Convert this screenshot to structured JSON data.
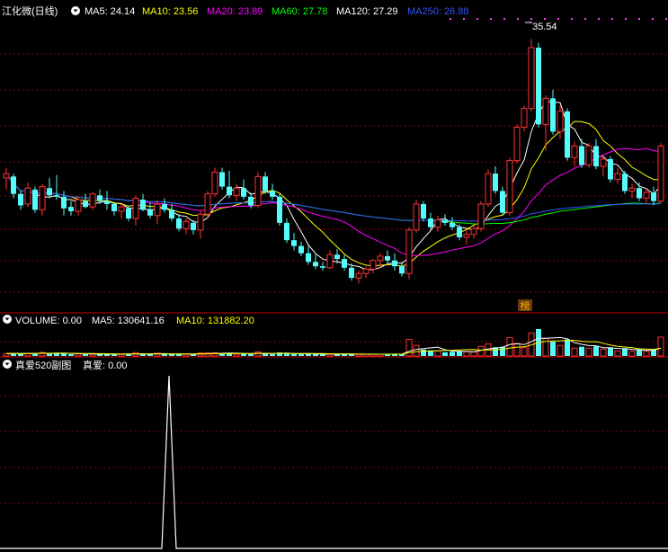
{
  "stock": {
    "name": "江化微(日线)"
  },
  "ma_legend": [
    {
      "text": "MA5: 24.14",
      "color": "#ffffff"
    },
    {
      "text": "MA10: 23.56",
      "color": "#ffff00"
    },
    {
      "text": "MA20: 23.89",
      "color": "#ff00ff"
    },
    {
      "text": "MA60: 27.78",
      "color": "#00ff00"
    },
    {
      "text": "MA120: 27.29",
      "color": "#ffffff"
    },
    {
      "text": "MA250: 26.88",
      "color": "#3355ff"
    }
  ],
  "peak_label": "35.54",
  "bang_label": "榜",
  "volume_legend": [
    {
      "text": "VOLUME: 0.00",
      "color": "#ffffff"
    },
    {
      "text": "MA5: 130641.16",
      "color": "#ffffff"
    },
    {
      "text": "MA10: 131882.20",
      "color": "#ffff00"
    }
  ],
  "sub_legend": {
    "name": "真爱520副图",
    "value": "真爱: 0.00"
  },
  "colors": {
    "up": "#ff3333",
    "down": "#54fcfc",
    "grid": "#8b0000",
    "bg": "#000000"
  },
  "chart_data": [
    {
      "type": "candlestick",
      "ylim": [
        18,
        37
      ],
      "candles": [
        [
          26.2,
          26.9,
          25.4,
          26.5
        ],
        [
          26.3,
          26.5,
          24.8,
          25.1
        ],
        [
          25.1,
          25.3,
          24.0,
          24.3
        ],
        [
          24.4,
          25.9,
          24.2,
          25.5
        ],
        [
          25.4,
          25.6,
          23.8,
          24.0
        ],
        [
          24.0,
          25.8,
          23.6,
          25.6
        ],
        [
          25.5,
          26.2,
          24.8,
          25.0
        ],
        [
          25.0,
          26.4,
          24.7,
          24.9
        ],
        [
          24.9,
          25.3,
          23.6,
          24.1
        ],
        [
          24.2,
          24.6,
          23.6,
          23.9
        ],
        [
          23.9,
          24.9,
          23.6,
          24.7
        ],
        [
          24.6,
          25.1,
          24.1,
          24.2
        ],
        [
          24.2,
          25.2,
          24.0,
          25.1
        ],
        [
          25.0,
          25.4,
          24.4,
          24.6
        ],
        [
          24.6,
          25.3,
          24.0,
          24.4
        ],
        [
          24.4,
          24.5,
          23.6,
          23.9
        ],
        [
          23.9,
          24.4,
          23.4,
          24.2
        ],
        [
          24.1,
          24.3,
          23.2,
          23.4
        ],
        [
          23.4,
          25.0,
          22.9,
          24.8
        ],
        [
          24.7,
          25.1,
          23.9,
          24.0
        ],
        [
          24.0,
          24.5,
          23.4,
          23.6
        ],
        [
          23.6,
          24.7,
          23.0,
          24.4
        ],
        [
          24.4,
          24.8,
          23.8,
          24.0
        ],
        [
          24.0,
          24.4,
          23.2,
          23.4
        ],
        [
          23.4,
          23.7,
          22.5,
          22.7
        ],
        [
          22.7,
          23.4,
          22.3,
          23.2
        ],
        [
          23.1,
          23.3,
          22.3,
          22.6
        ],
        [
          22.6,
          23.9,
          22.0,
          23.7
        ],
        [
          23.7,
          25.3,
          23.4,
          25.1
        ],
        [
          25.1,
          26.9,
          24.9,
          26.6
        ],
        [
          26.6,
          26.9,
          25.4,
          25.6
        ],
        [
          25.6,
          26.7,
          24.8,
          25.0
        ],
        [
          25.0,
          25.8,
          24.6,
          25.5
        ],
        [
          25.5,
          26.1,
          24.7,
          24.9
        ],
        [
          24.9,
          25.2,
          24.1,
          24.3
        ],
        [
          24.3,
          26.6,
          24.1,
          26.3
        ],
        [
          26.3,
          26.6,
          25.1,
          25.3
        ],
        [
          25.3,
          25.8,
          24.7,
          24.9
        ],
        [
          24.9,
          25.1,
          22.9,
          23.1
        ],
        [
          23.1,
          23.4,
          21.7,
          21.9
        ],
        [
          21.9,
          22.4,
          21.2,
          21.5
        ],
        [
          21.5,
          21.8,
          20.8,
          21.0
        ],
        [
          21.0,
          21.5,
          20.2,
          20.4
        ],
        [
          20.4,
          20.9,
          19.9,
          20.1
        ],
        [
          20.1,
          20.4,
          19.8,
          20.0
        ],
        [
          20.0,
          21.2,
          19.9,
          20.9
        ],
        [
          20.9,
          21.3,
          20.3,
          20.6
        ],
        [
          20.6,
          20.9,
          19.8,
          20.0
        ],
        [
          20.0,
          20.3,
          19.1,
          19.3
        ],
        [
          19.3,
          19.8,
          18.9,
          19.6
        ],
        [
          19.6,
          20.1,
          19.3,
          19.9
        ],
        [
          19.9,
          20.6,
          19.6,
          20.5
        ],
        [
          20.5,
          21.0,
          20.0,
          20.8
        ],
        [
          20.8,
          21.2,
          20.2,
          20.5
        ],
        [
          20.5,
          21.0,
          19.8,
          20.1
        ],
        [
          20.1,
          20.4,
          19.4,
          19.6
        ],
        [
          19.6,
          22.8,
          19.2,
          22.6
        ],
        [
          22.6,
          24.7,
          22.4,
          24.4
        ],
        [
          24.4,
          24.6,
          23.2,
          23.4
        ],
        [
          23.4,
          23.8,
          22.6,
          22.8
        ],
        [
          22.8,
          23.6,
          22.5,
          23.3
        ],
        [
          23.3,
          23.7,
          22.9,
          23.1
        ],
        [
          23.1,
          23.5,
          22.6,
          22.8
        ],
        [
          22.8,
          23.0,
          21.9,
          22.1
        ],
        [
          22.1,
          22.6,
          21.6,
          22.3
        ],
        [
          22.3,
          22.9,
          22.0,
          22.7
        ],
        [
          22.7,
          24.6,
          22.5,
          24.4
        ],
        [
          24.4,
          26.8,
          24.2,
          26.5
        ],
        [
          26.5,
          27.0,
          25.1,
          25.3
        ],
        [
          25.3,
          25.6,
          23.6,
          23.8
        ],
        [
          23.8,
          27.6,
          23.6,
          27.4
        ],
        [
          27.4,
          29.9,
          27.2,
          29.7
        ],
        [
          29.7,
          31.2,
          29.4,
          31.0
        ],
        [
          31.0,
          35.8,
          30.8,
          35.2
        ],
        [
          35.2,
          35.54,
          29.7,
          29.9
        ],
        [
          29.9,
          31.9,
          28.1,
          31.7
        ],
        [
          31.7,
          32.3,
          29.2,
          29.4
        ],
        [
          29.4,
          31.2,
          28.9,
          30.8
        ],
        [
          30.8,
          31.0,
          27.4,
          27.6
        ],
        [
          27.6,
          28.7,
          27.0,
          28.4
        ],
        [
          28.4,
          28.9,
          26.9,
          27.1
        ],
        [
          27.1,
          28.6,
          26.9,
          28.4
        ],
        [
          28.4,
          28.9,
          26.8,
          27.0
        ],
        [
          27.0,
          27.8,
          26.3,
          27.5
        ],
        [
          27.5,
          27.7,
          25.9,
          26.1
        ],
        [
          26.1,
          26.9,
          25.8,
          26.5
        ],
        [
          26.5,
          26.7,
          25.1,
          25.3
        ],
        [
          25.3,
          25.8,
          24.8,
          25.5
        ],
        [
          25.5,
          25.9,
          24.6,
          24.8
        ],
        [
          24.8,
          25.4,
          24.4,
          25.2
        ],
        [
          25.2,
          25.6,
          24.3,
          24.6
        ],
        [
          24.6,
          28.6,
          24.5,
          28.4
        ]
      ]
    },
    {
      "type": "bar",
      "title": "VOLUME"
    },
    {
      "type": "line",
      "title": "真爱520副图",
      "values": [
        0,
        0,
        0,
        0,
        0,
        0,
        0,
        0,
        0,
        0,
        0,
        0,
        0,
        0,
        0,
        0,
        0,
        0,
        0,
        0,
        0,
        0,
        0,
        0,
        0,
        0,
        0,
        0,
        0,
        0,
        0,
        1,
        0,
        0,
        0,
        0,
        0,
        0,
        0,
        0,
        0,
        0,
        0,
        0,
        0,
        0,
        0,
        0,
        0,
        0,
        0,
        0,
        0,
        0,
        0,
        0,
        0,
        0,
        0,
        0,
        0,
        0,
        0,
        0,
        0,
        0,
        0,
        0,
        0,
        0,
        0,
        0,
        0,
        0,
        0,
        0,
        0,
        0,
        0,
        0,
        0,
        0,
        0,
        0,
        0,
        0,
        0,
        0,
        0,
        0,
        0,
        0
      ]
    }
  ]
}
